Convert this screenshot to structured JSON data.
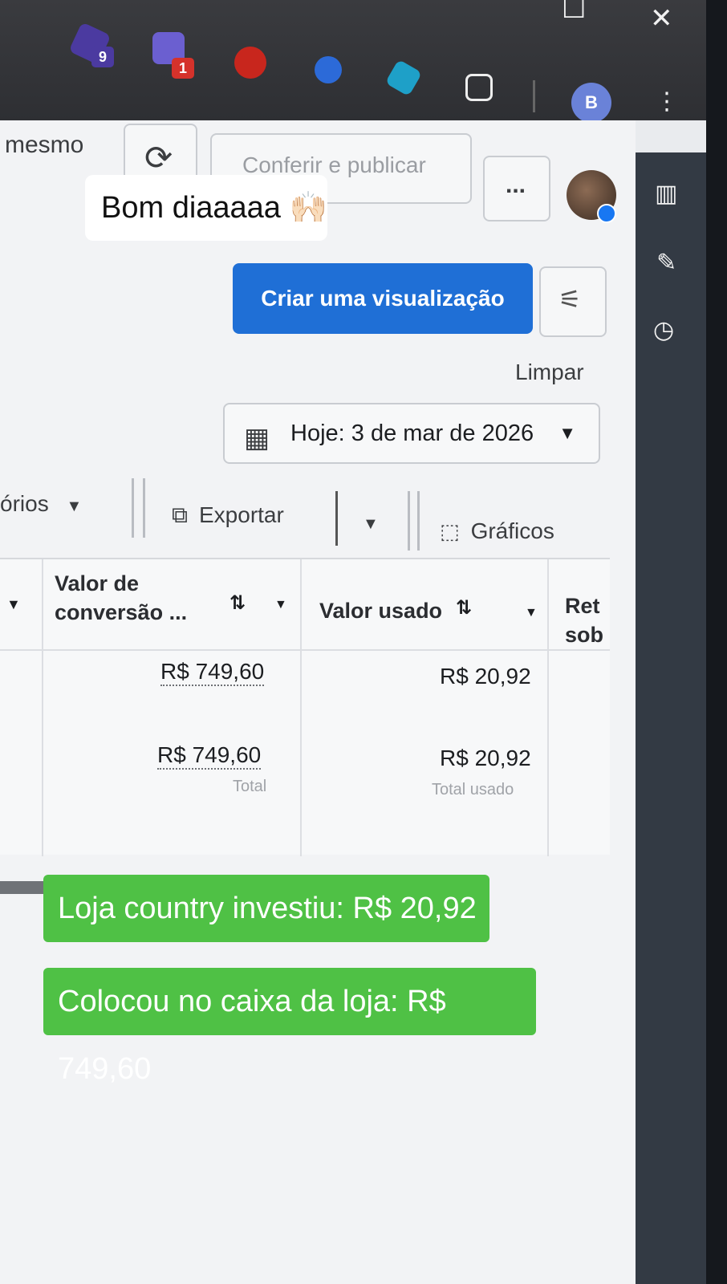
{
  "browser": {
    "extensions": [
      {
        "name": "ext-purple-badge",
        "badge": "9"
      },
      {
        "name": "ext-f-badge",
        "badge": "1"
      }
    ],
    "profile_initial": "B"
  },
  "toolbar": {
    "left_text": "mesmo",
    "review_publish": "Conferir e publicar",
    "more": "...",
    "create_view": "Criar uma visualização",
    "clear": "Limpar",
    "date_range": "Hoje: 3 de mar de 2026",
    "reports_label": "órios",
    "export": "Exportar",
    "charts": "Gráficos"
  },
  "table": {
    "col_conv": "Valor de conversão ...",
    "col_spent": "Valor usado",
    "col_ret": "Ret sob",
    "rows": [
      {
        "conv": "R$ 749,60",
        "spent": "R$ 20,92"
      }
    ],
    "totals": {
      "conv": "R$ 749,60",
      "conv_sub": "Total",
      "spent": "R$ 20,92",
      "spent_sub": "Total usado"
    }
  },
  "overlays": {
    "greeting": "Bom diaaaaa 🙌🏻",
    "line1": "Loja country investiu: R$ 20,92",
    "line2": "Colocou no caixa da loja: R$ 749,60"
  }
}
